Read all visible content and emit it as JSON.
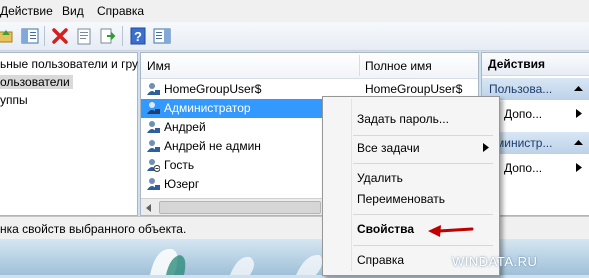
{
  "menu": {
    "action": "Действие",
    "view": "Вид",
    "help": "Справка"
  },
  "tree": {
    "items": [
      "ьные пользователи и гру",
      "ользователи",
      "уппы"
    ]
  },
  "list": {
    "headers": {
      "name": "Имя",
      "full_name": "Полное имя"
    },
    "rows": [
      {
        "name": "HomeGroupUser$",
        "full_name": "HomeGroupUser$"
      },
      {
        "name": "Администратор",
        "full_name": ""
      },
      {
        "name": "Андрей",
        "full_name": ""
      },
      {
        "name": "Андрей не админ",
        "full_name": ""
      },
      {
        "name": "Гость",
        "full_name": ""
      },
      {
        "name": "Юзерг",
        "full_name": ""
      }
    ]
  },
  "actions": {
    "title": "Действия",
    "group1": "Пользова...",
    "link1": "Допо...",
    "group2": "дминистр...",
    "link2": "Допо..."
  },
  "status": {
    "text": "нка свойств выбранного объекта."
  },
  "context_menu": {
    "set_password": "Задать пароль...",
    "all_tasks": "Все задачи",
    "delete": "Удалить",
    "rename": "Переименовать",
    "properties": "Свойства",
    "help": "Справка"
  },
  "watermark": "WINDATA.RU",
  "colors": {
    "selection": "#3399ff",
    "arrow": "#c00000"
  }
}
